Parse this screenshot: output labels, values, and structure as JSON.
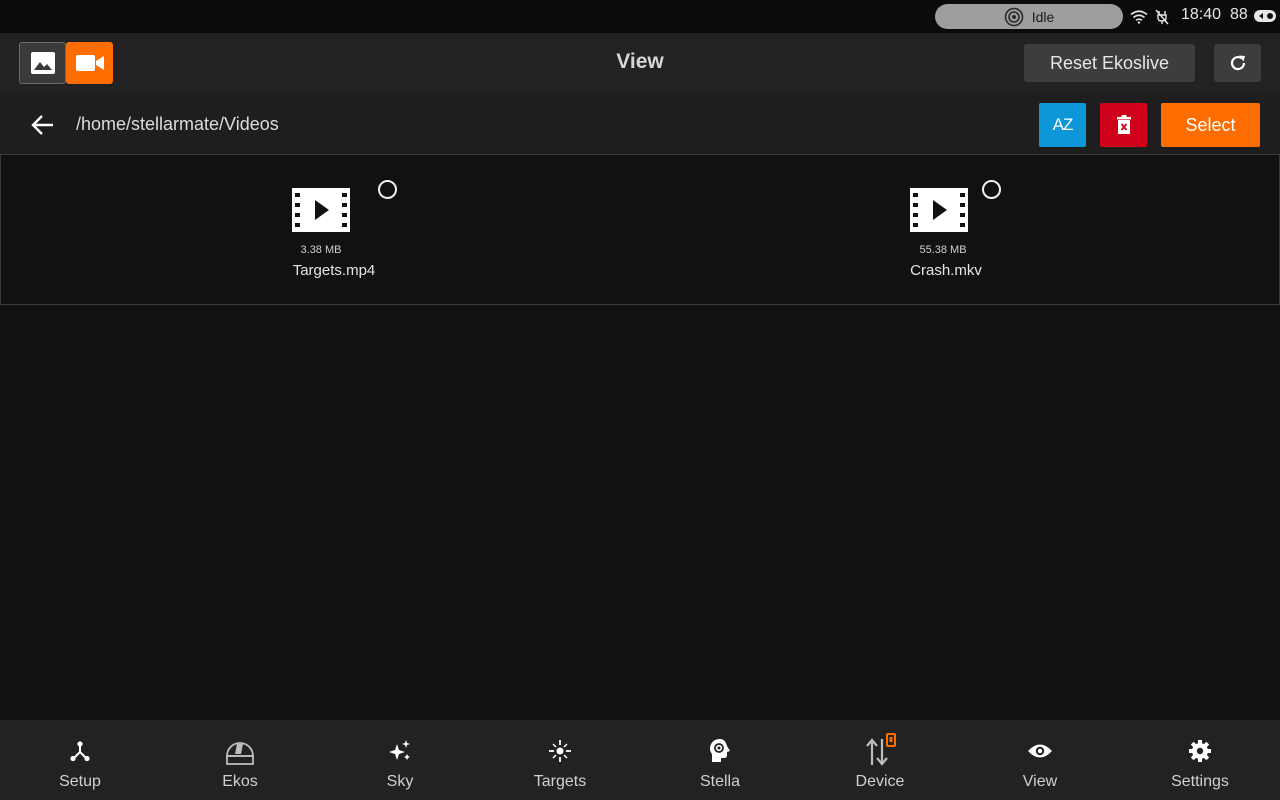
{
  "status_bar": {
    "state": "Idle",
    "time": "18:40",
    "battery": "88"
  },
  "app_bar": {
    "title": "View",
    "reset_label": "Reset Ekoslive",
    "photo_icon": "image-icon",
    "video_icon": "video-camera-icon",
    "refresh_icon": "refresh-icon",
    "active_mode_color": "#ff6d00"
  },
  "path_bar": {
    "path": "/home/stellarmate/Videos",
    "sort_label": "AZ",
    "select_label": "Select",
    "sort_color": "#0d97d8",
    "delete_color": "#d0021b",
    "select_color": "#ff6d00"
  },
  "files": [
    {
      "name": "Targets.mp4",
      "size": "3.38 MB",
      "icon": "video-file-icon",
      "selected": false
    },
    {
      "name": "Crash.mkv",
      "size": "55.38 MB",
      "icon": "video-file-icon",
      "selected": false
    }
  ],
  "bottom_nav": [
    {
      "label": "Setup",
      "icon": "setup-icon"
    },
    {
      "label": "Ekos",
      "icon": "observatory-dome-icon"
    },
    {
      "label": "Sky",
      "icon": "sparkles-icon"
    },
    {
      "label": "Targets",
      "icon": "target-crosshair-icon"
    },
    {
      "label": "Stella",
      "icon": "ai-head-icon"
    },
    {
      "label": "Device",
      "icon": "device-transfer-icon"
    },
    {
      "label": "View",
      "icon": "eye-icon"
    },
    {
      "label": "Settings",
      "icon": "gear-icon"
    }
  ]
}
